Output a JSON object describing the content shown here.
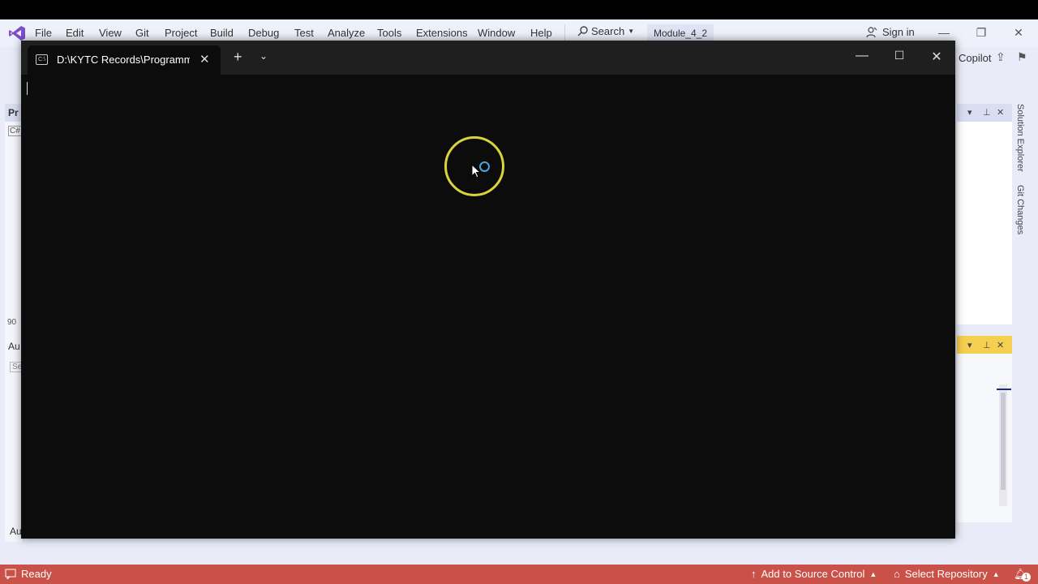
{
  "menubar": {
    "items": [
      "File",
      "Edit",
      "View",
      "Git",
      "Project",
      "Build",
      "Debug",
      "Test",
      "Analyze",
      "Tools",
      "Extensions",
      "Window",
      "Help"
    ],
    "search_label": "Search",
    "solution_name": "Module_4_2",
    "sign_in": "Sign in",
    "copilot": "Copilot"
  },
  "left_panel": {
    "title": "Pr",
    "zoom": "90",
    "bottom_title": "Au",
    "search_placeholder": "Se",
    "footer": "Au"
  },
  "right_tabs": {
    "solution_explorer": "Solution Explorer",
    "git_changes": "Git Changes"
  },
  "terminal": {
    "tab_title": "D:\\KYTC Records\\Programmir",
    "icon_text": "C:\\"
  },
  "statusbar": {
    "ready": "Ready",
    "source_control": "Add to Source Control",
    "select_repo": "Select Repository",
    "notifications": "1"
  },
  "colors": {
    "status_bg": "#ca5148",
    "terminal_bg": "#0c0c0c",
    "ide_bg": "#e9ebf8",
    "accent": "#7b4fc8"
  }
}
